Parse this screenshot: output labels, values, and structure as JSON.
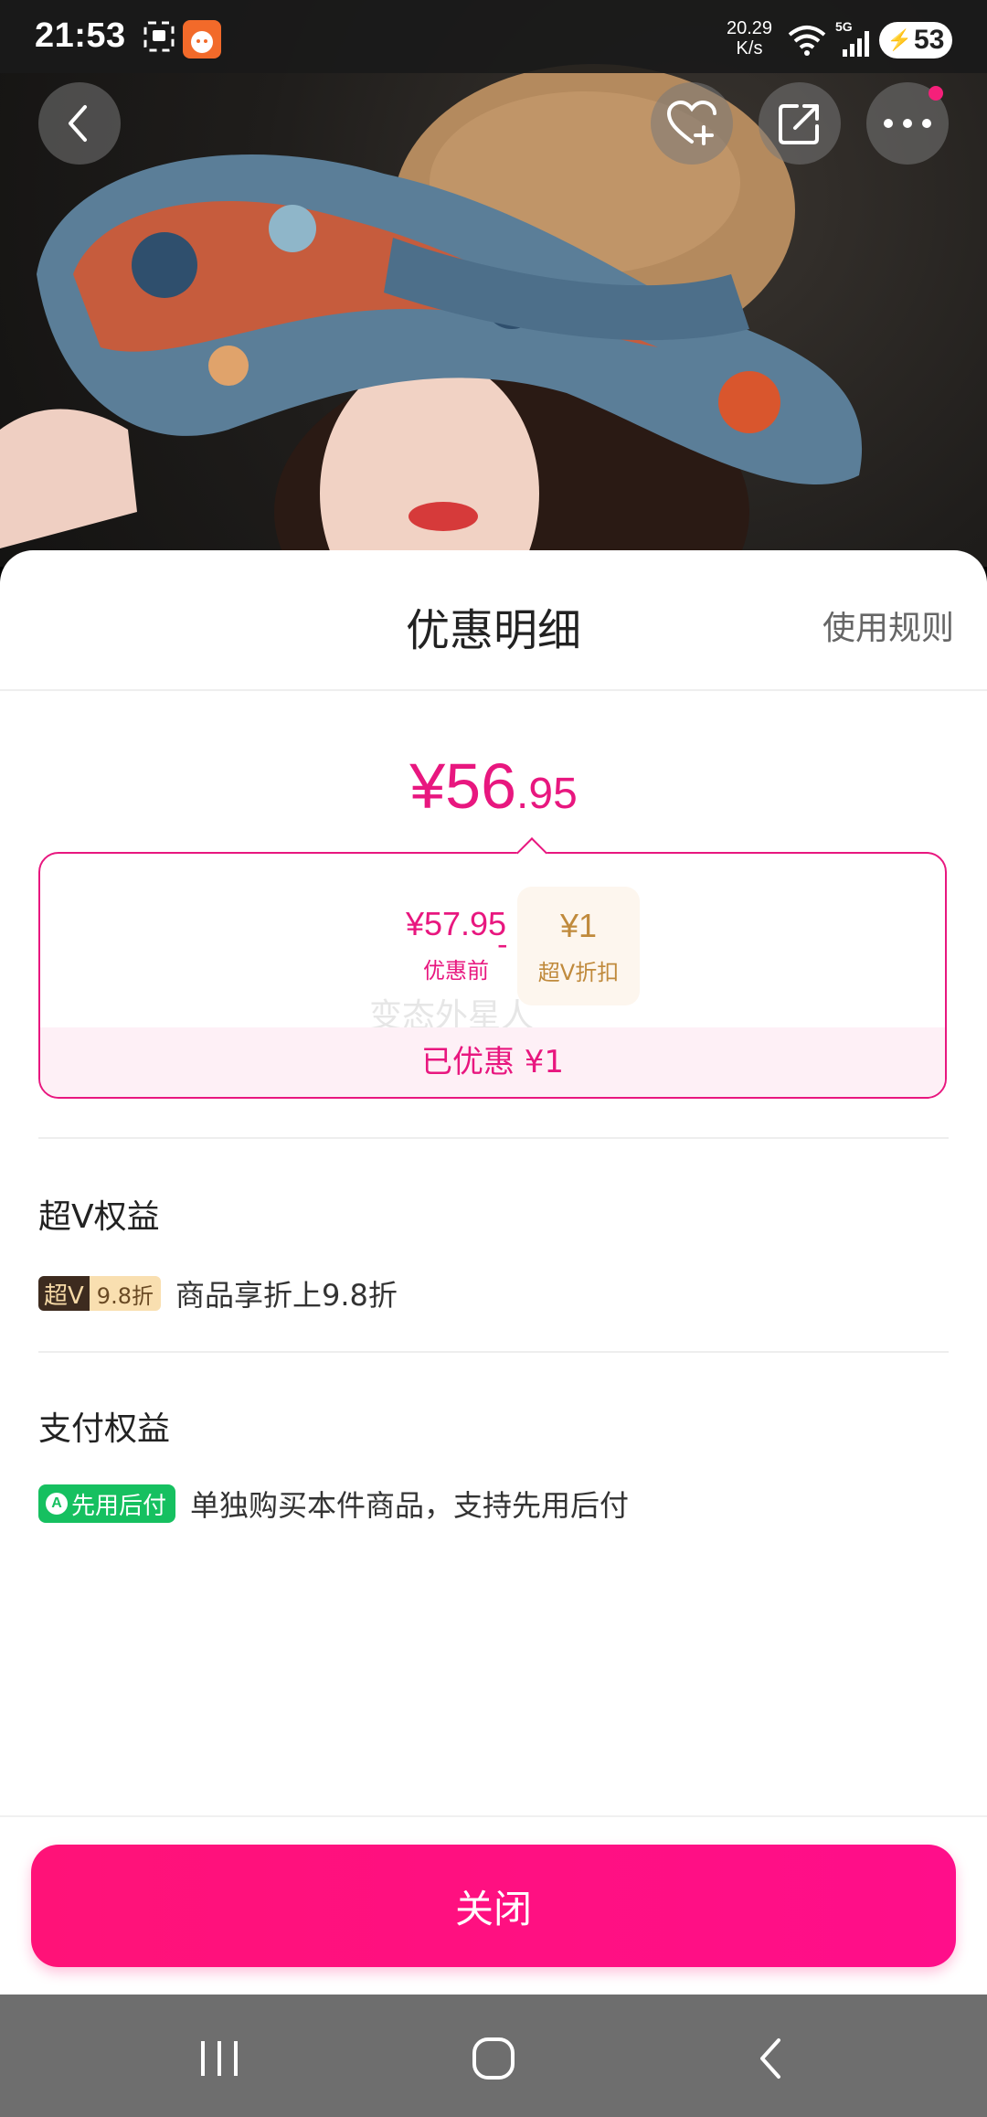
{
  "status_bar": {
    "time": "21:53",
    "net_speed_value": "20.29",
    "net_speed_unit": "K/s",
    "network": "5G",
    "battery": "53",
    "icons": [
      "screenshot-icon",
      "app-notification-icon",
      "wifi-icon",
      "cell-signal-icon",
      "battery-charging-icon"
    ]
  },
  "top_actions": {
    "icons": [
      "back-icon",
      "favorite-add-icon",
      "share-icon",
      "more-icon"
    ]
  },
  "sheet": {
    "title": "优惠明细",
    "rules_link": "使用规则",
    "final_price_main": "¥56",
    "final_price_decimal": ".95",
    "calc": {
      "original_amount": "¥57.95",
      "original_label": "优惠前",
      "operator": "-",
      "discount_amount": "¥1",
      "discount_label": "超V折扣",
      "watermark": "变态外星人",
      "saved_text": "已优惠 ¥1"
    },
    "super_v": {
      "section_title": "超V权益",
      "badge_left": "超V",
      "badge_right": "9.8折",
      "text": "商品享折上9.8折"
    },
    "payment": {
      "section_title": "支付权益",
      "badge_icon": "A",
      "badge_text": "先用后付",
      "text": "单独购买本件商品，支持先用后付"
    },
    "close_button": "关闭"
  },
  "nav_bar": {
    "icons": [
      "recent-apps-icon",
      "home-icon",
      "nav-back-icon"
    ]
  },
  "colors": {
    "accent": "#e8177f",
    "button": "#ff1278",
    "gold": "#c08a3c",
    "pay_green": "#16c060"
  }
}
